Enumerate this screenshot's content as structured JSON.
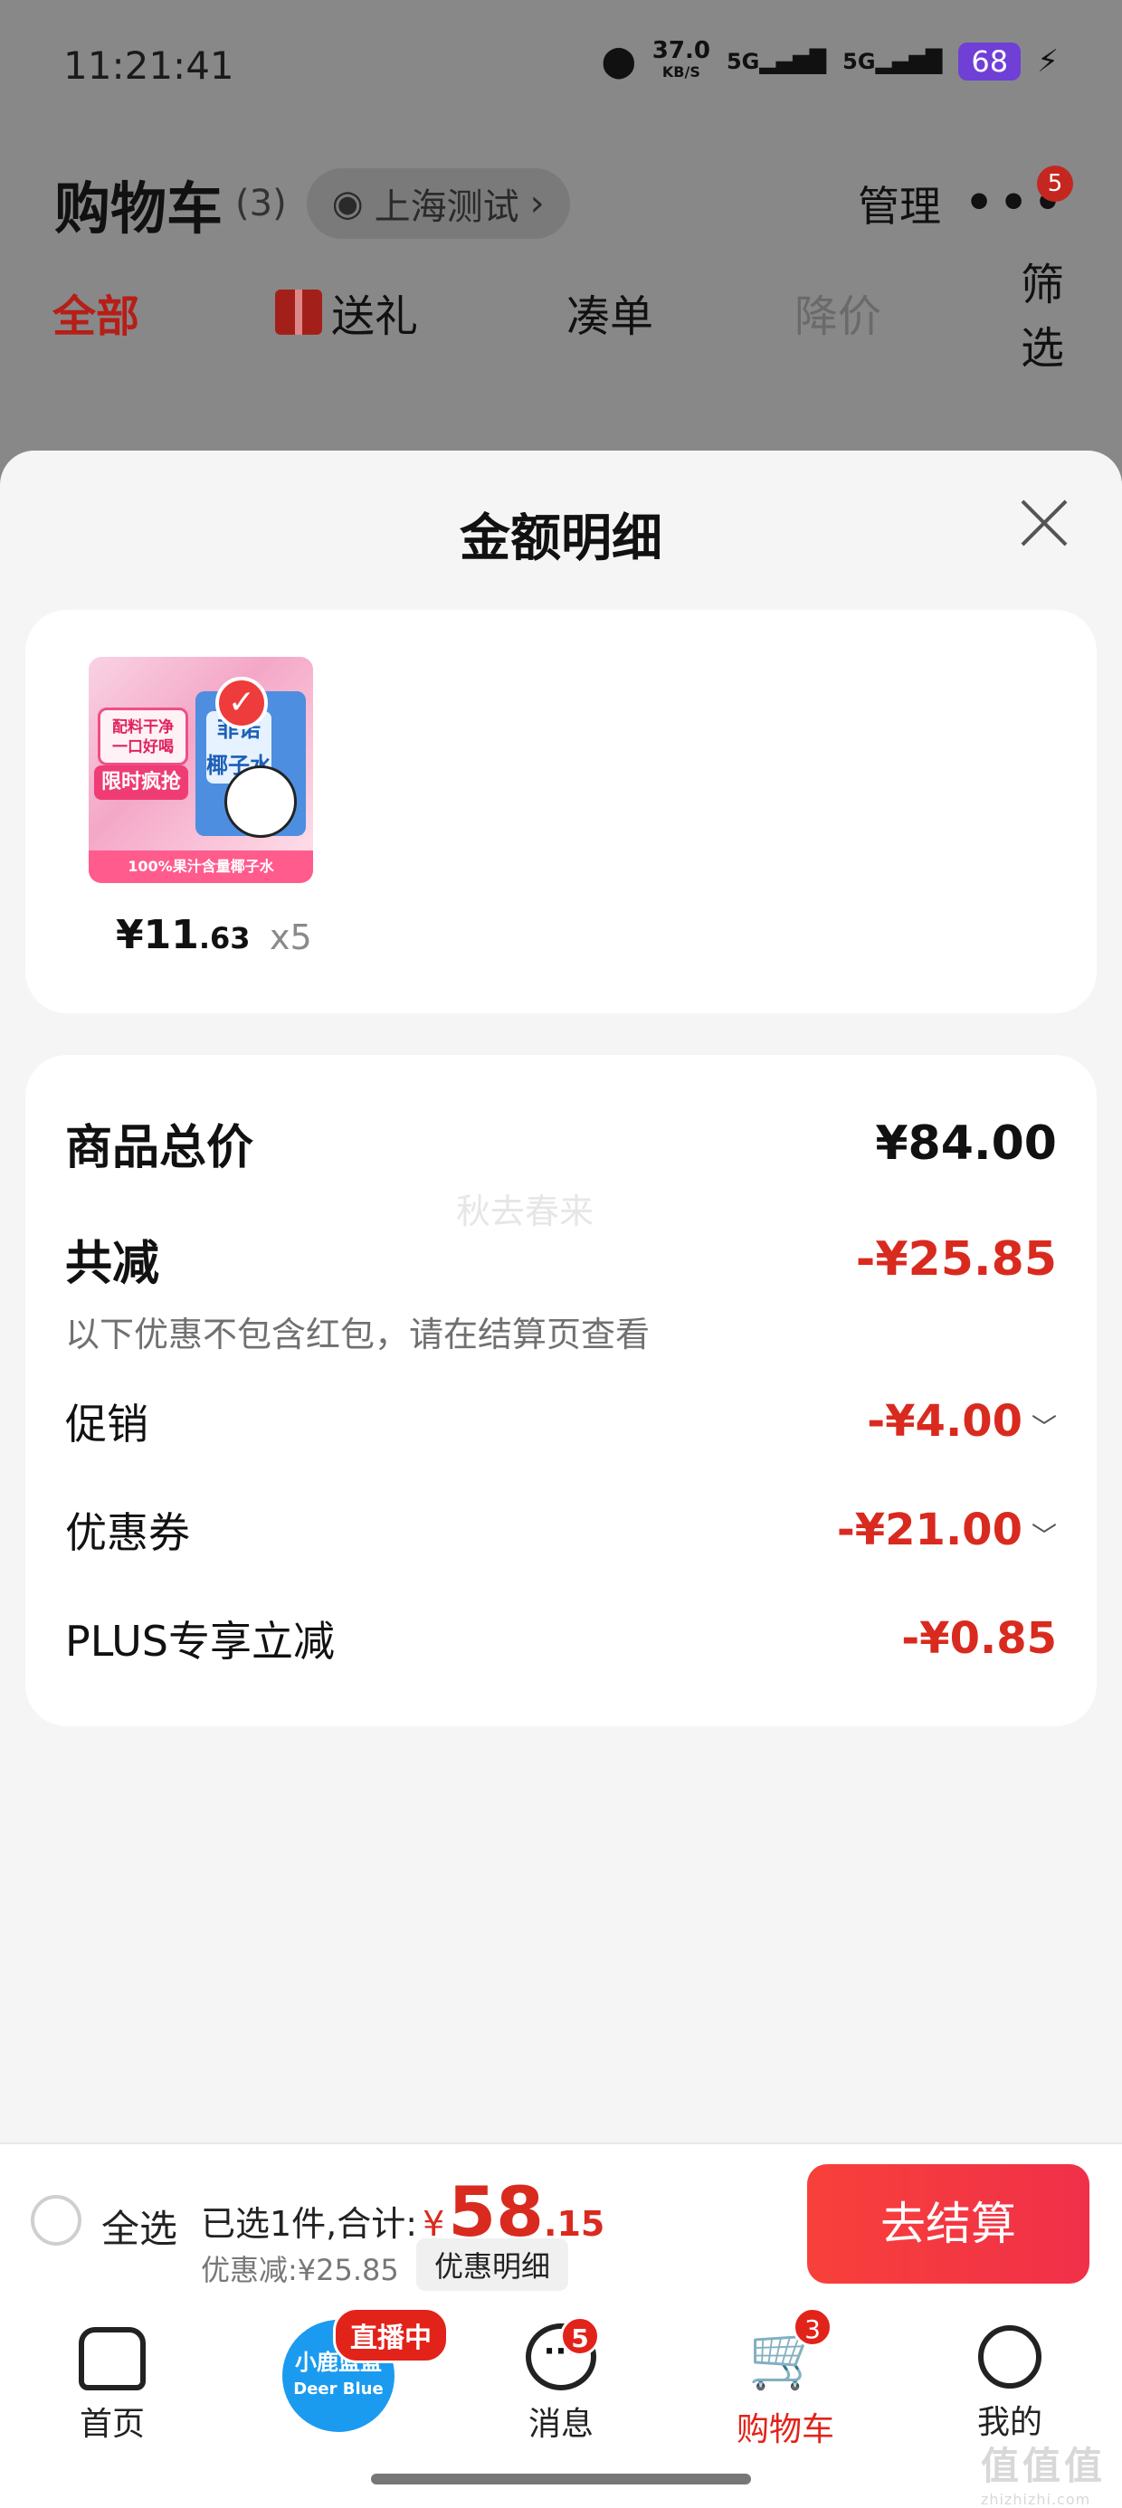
{
  "status_bar": {
    "time": "11:21:41",
    "net_speed": "37.0",
    "net_unit": "KB/S",
    "sig1": "5G",
    "sig2": "5G",
    "battery": "68"
  },
  "header": {
    "title": "购物车",
    "count": "(3)",
    "location": "上海测试",
    "location_chevron": "›",
    "manage": "管理",
    "more": "•••",
    "more_badge": "5"
  },
  "filter_tabs": {
    "all": "全部",
    "gift": "送礼",
    "bundle": "凑单",
    "price_drop": "降价",
    "filter": "筛选"
  },
  "sheet": {
    "title": "金额明细",
    "product": {
      "price_int": "¥11",
      "price_dec": ".63",
      "qty": "x5",
      "thumb_text_a": "配料干净\n一口好喝",
      "thumb_text_b": "限时疯抢",
      "thumb_text_c": "菲诺\n椰子水",
      "thumb_bottom": "100%果汁含量椰子水"
    },
    "watermark": "秋去春来",
    "rows": {
      "total_label": "商品总价",
      "total_value": "¥84.00",
      "reduce_label": "共减",
      "reduce_value": "-¥25.85",
      "note": "以下优惠不包含红包，请在结算页查看",
      "promo_label": "促销",
      "promo_value": "-¥4.00",
      "coupon_label": "优惠券",
      "coupon_value": "-¥21.00",
      "plus_label": "PLUS专享立减",
      "plus_value": "-¥0.85"
    }
  },
  "checkout": {
    "select_all": "全选",
    "selected_text": "已选1件,合计:",
    "currency": "¥",
    "total_int": "58",
    "total_dec": ".15",
    "discount_text": "优惠减:¥25.85",
    "discount_detail": "优惠明细",
    "checkout_button": "去结算"
  },
  "tab_bar": {
    "home": "首页",
    "live_brand": "小鹿蓝蓝",
    "live_brand_en": "Deer Blue",
    "live_badge": "直播中",
    "messages": "消息",
    "messages_badge": "5",
    "cart": "购物车",
    "cart_badge": "3",
    "me": "我的"
  },
  "corner_watermark": {
    "main": "值值值",
    "sub": "zhizhizhi.com"
  },
  "colors": {
    "accent_red": "#d92a1f",
    "checkout_red": "#f8403a",
    "live_blue": "#1a9bf0"
  }
}
